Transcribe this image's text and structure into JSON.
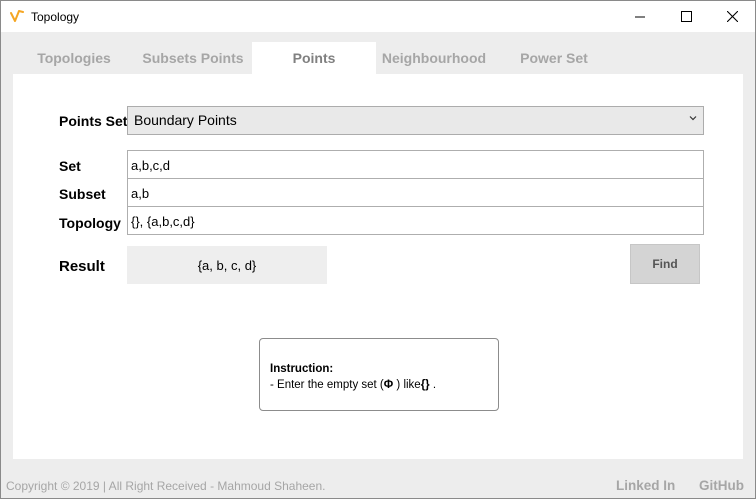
{
  "window": {
    "title": "Topology",
    "accent_color": "#f5a623"
  },
  "tabs": [
    {
      "label": "Topologies",
      "active": false
    },
    {
      "label": "Subsets Points",
      "active": false
    },
    {
      "label": "Points",
      "active": true
    },
    {
      "label": "Neighbourhood",
      "active": false
    },
    {
      "label": "Power Set",
      "active": false
    }
  ],
  "form": {
    "points_set_label": "Points Set",
    "points_set_value": "Boundary Points",
    "set_label": "Set",
    "set_value": "a,b,c,d",
    "subset_label": "Subset",
    "subset_value": "a,b",
    "topology_label": "Topology",
    "topology_value": "{}, {a,b,c,d}",
    "result_label": "Result",
    "result_value": "{a, b, c, d}",
    "find_label": "Find"
  },
  "instruction": {
    "title": "Instruction:",
    "text_prefix": "- Enter the empty set (",
    "phi": "Φ",
    "text_middle": " ) like",
    "braces": "{}",
    "text_suffix": " ."
  },
  "footer": {
    "copyright": "Copyright © 2019 | All Right Received - Mahmoud Shaheen.",
    "linkedin": "Linked In",
    "github": "GitHub"
  }
}
